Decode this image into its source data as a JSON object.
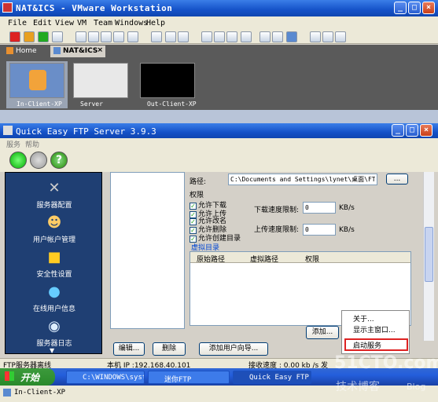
{
  "vmware": {
    "title": "NAT&ICS - VMware Workstation",
    "menu": [
      "File",
      "Edit",
      "View",
      "VM",
      "Team",
      "Windows",
      "Help"
    ],
    "tabs": [
      {
        "label": "Home"
      },
      {
        "label": "NAT&ICS"
      }
    ],
    "vms": [
      {
        "label": "In-Client-XP"
      },
      {
        "label": "Server"
      },
      {
        "label": "Out-Client-XP"
      }
    ],
    "status_vm": "In-Client-XP"
  },
  "ftp": {
    "title": "Quick Easy FTP Server 3.9.3",
    "menu": [
      "服务",
      "帮助"
    ],
    "sidebar": [
      {
        "label": "服务器配置",
        "icon": "wrench-icon"
      },
      {
        "label": "用户帐户管理",
        "icon": "users-icon"
      },
      {
        "label": "安全性设置",
        "icon": "lock-icon"
      },
      {
        "label": "在线用户信息",
        "icon": "globe-icon"
      },
      {
        "label": "服务器日志",
        "icon": "magnifier-icon"
      }
    ],
    "config": {
      "path_label": "路径:",
      "path_value": "C:\\Documents and Settings\\lynet\\桌面\\FTP",
      "browse_label": "...",
      "perm_label": "权限",
      "perms": [
        "允许下载",
        "允许上传",
        "允许改名",
        "允许删除",
        "允许创建目录"
      ],
      "download_limit_label": "下载速度限制:",
      "download_limit": "0",
      "upload_limit_label": "上传速度限制:",
      "upload_limit": "0",
      "unit": "KB/s",
      "vdir_label": "虚拟目录",
      "vdir_cols": [
        "原始路径",
        "虚拟路径",
        "权限"
      ],
      "add_label": "添加..."
    },
    "buttons": {
      "edit": "编辑...",
      "delete": "删除",
      "wizard": "添加用户向导..."
    },
    "context_menu": [
      "关于...",
      "显示主窗口...",
      "启动服务"
    ],
    "status": {
      "left": "FTP服务器离线",
      "ip": "本机 IP :192.168.40.101",
      "speed": "接收速度 : 0.00  kb /s 发"
    }
  },
  "taskbar": {
    "start": "开始",
    "items": [
      "C:\\WINDOWS\\syst...",
      "迷你FTP",
      "Quick Easy FTP ..."
    ]
  },
  "watermark": {
    "site": "51CTO.com",
    "sub": "技术博客",
    "blog": "Blog"
  },
  "colors": {
    "titlebar": "#1552c8",
    "sidebar": "#1f3f73",
    "highlight": "#dd2222"
  }
}
